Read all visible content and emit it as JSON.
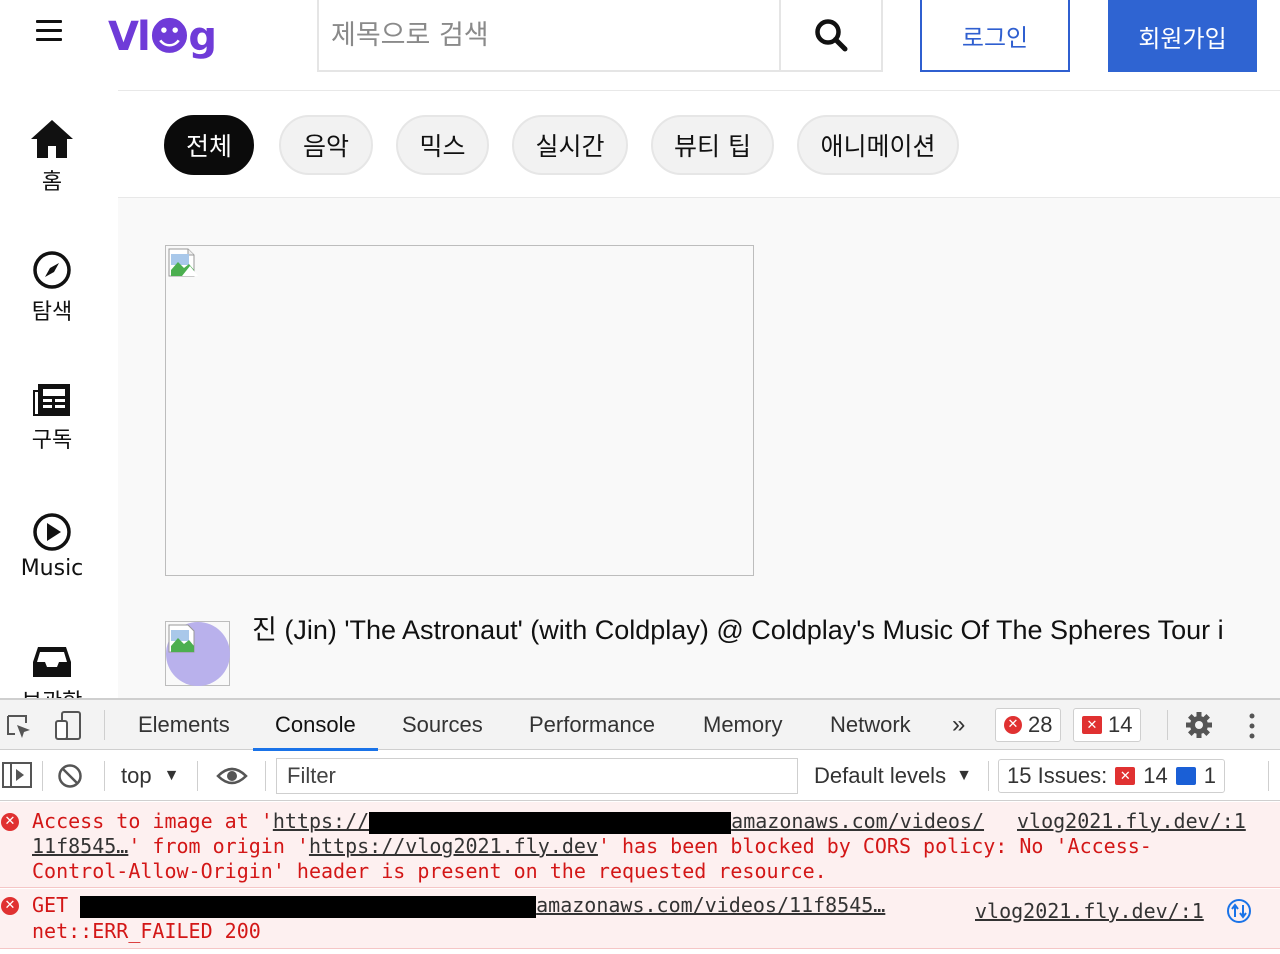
{
  "header": {
    "logo": "Vl☻g",
    "search_placeholder": "제목으로 검색",
    "login_label": "로그인",
    "signup_label": "회원가입"
  },
  "sidebar": {
    "items": [
      {
        "label": "홈",
        "icon": "home-icon"
      },
      {
        "label": "탐색",
        "icon": "compass-icon"
      },
      {
        "label": "구독",
        "icon": "subscriptions-icon"
      },
      {
        "label": "Music",
        "icon": "play-circle-icon"
      },
      {
        "label": "보관함",
        "icon": "inbox-icon"
      }
    ]
  },
  "chips": [
    "전체",
    "음악",
    "믹스",
    "실시간",
    "뷰티 팁",
    "애니메이션"
  ],
  "video": {
    "title": "진 (Jin) 'The Astronaut' (with Coldplay) @ Coldplay's Music Of The Spheres Tour i"
  },
  "devtools": {
    "tabs": [
      "Elements",
      "Console",
      "Sources",
      "Performance",
      "Memory",
      "Network"
    ],
    "active_tab": "Console",
    "error_count": "28",
    "warning_count": "14",
    "context": "top",
    "filter_placeholder": "Filter",
    "default_levels": "Default levels",
    "issues_label": "15 Issues:",
    "issues_errors": "14",
    "issues_info": "1",
    "messages": [
      {
        "line1_prefix": "Access to image at '",
        "line1_link_start": "https://",
        "line1_link_end": "amazonaws.com/videos/",
        "line2_link": "11f8545…",
        "line2_a": "' from origin '",
        "line2_origin": "https://vlog2021.fly.dev",
        "line2_b": "' has been blocked by CORS policy: No 'Access-",
        "line3": "Control-Allow-Origin' header is present on the requested resource.",
        "source": "vlog2021.fly.dev/:1"
      },
      {
        "method": "GET",
        "url_end": "amazonaws.com/videos/11f8545…",
        "line2": "net::ERR_FAILED 200",
        "source": "vlog2021.fly.dev/:1"
      }
    ]
  },
  "colors": {
    "brand": "#6f3bd8",
    "primary": "#2f64d2",
    "error": "#d31717"
  }
}
